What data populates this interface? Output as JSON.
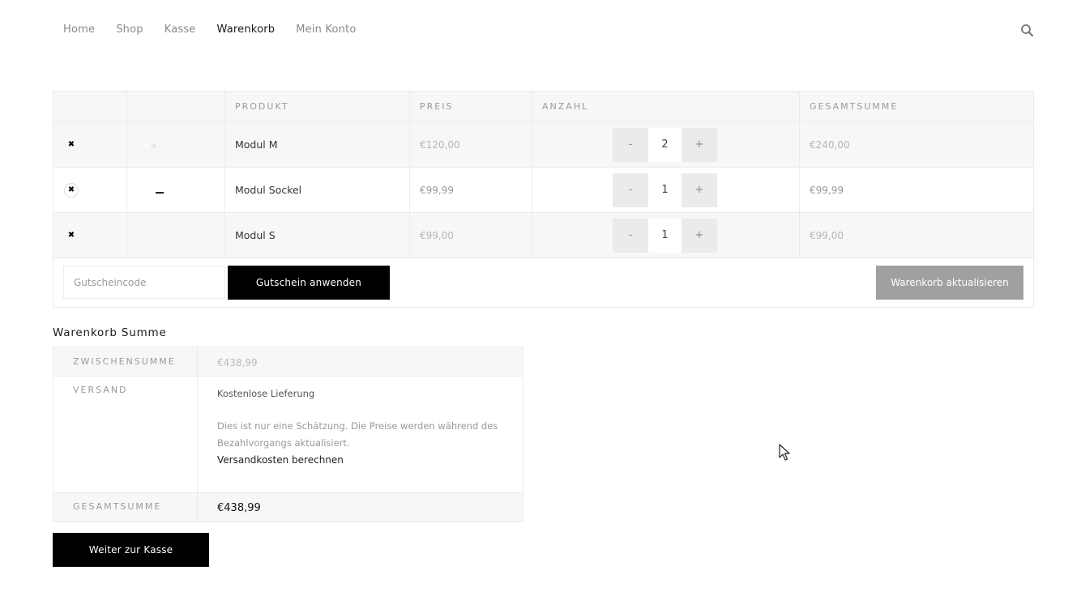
{
  "nav": {
    "items": [
      {
        "label": "Home"
      },
      {
        "label": "Shop"
      },
      {
        "label": "Kasse"
      },
      {
        "label": "Warenkorb"
      },
      {
        "label": "Mein Konto"
      }
    ],
    "active": "Warenkorb",
    "search_icon": "search-icon"
  },
  "cart": {
    "headers": {
      "product": "PRODUKT",
      "price": "PREIS",
      "quantity": "ANZAHL",
      "subtotal": "GESAMTSUMME"
    },
    "items": [
      {
        "name": "Modul M",
        "price": "€120,00",
        "quantity": "2",
        "subtotal": "€240,00"
      },
      {
        "name": "Modul Sockel",
        "price": "€99,99",
        "quantity": "1",
        "subtotal": "€99,99"
      },
      {
        "name": "Modul S",
        "price": "€99,00",
        "quantity": "1",
        "subtotal": "€99,00"
      }
    ],
    "remove_symbol": "✖",
    "qty_minus": "-",
    "qty_plus": "+",
    "coupon_placeholder": "Gutscheincode",
    "apply_coupon_label": "Gutschein anwenden",
    "update_cart_label": "Warenkorb aktualisieren"
  },
  "totals": {
    "title": "Warenkorb Summe",
    "subtotal_label": "ZWISCHENSUMME",
    "subtotal_value": "€438,99",
    "shipping_label": "VERSAND",
    "shipping_method": "Kostenlose Lieferung",
    "shipping_note": "Dies ist nur eine Schätzung. Die Preise werden während des Bezahlvorgangs aktualisiert.",
    "shipping_calc_link": "Versandkosten berechnen",
    "total_label": "GESAMTSUMME",
    "total_value": "€438,99",
    "checkout_label": "Weiter zur Kasse"
  },
  "colors": {
    "primary_button": "#000000",
    "disabled_button": "#a0a0a0",
    "row_shade": "#f7f7f7",
    "border": "#ebebeb"
  }
}
